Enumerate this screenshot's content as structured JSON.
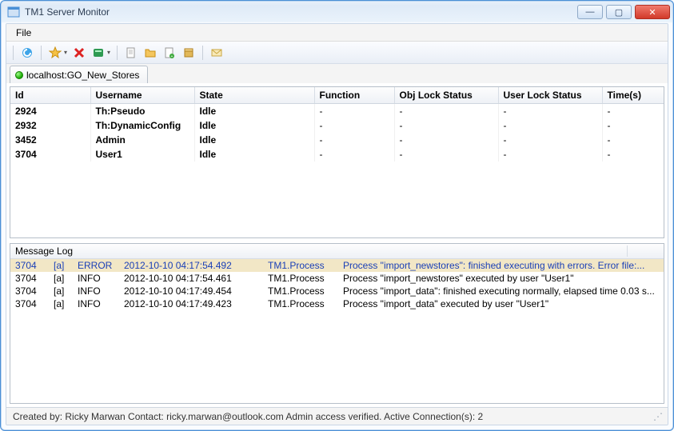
{
  "window": {
    "title": "TM1 Server Monitor"
  },
  "menubar": {
    "file": "File"
  },
  "toolbar_icons": [
    "refresh",
    "favorite",
    "delete",
    "server",
    "page",
    "folder",
    "page-add",
    "box",
    "mail"
  ],
  "tab": {
    "label": "localhost:GO_New_Stores"
  },
  "grid": {
    "headers": [
      "Id",
      "Username",
      "State",
      "Function",
      "Obj Lock Status",
      "User Lock Status",
      "Time(s)"
    ],
    "rows": [
      {
        "id": "2924",
        "user": "Th:Pseudo",
        "state": "Idle",
        "fn": "-",
        "obj": "-",
        "usr": "-",
        "time": "-"
      },
      {
        "id": "2932",
        "user": "Th:DynamicConfig",
        "state": "Idle",
        "fn": "-",
        "obj": "-",
        "usr": "-",
        "time": "-"
      },
      {
        "id": "3452",
        "user": "Admin",
        "state": "Idle",
        "fn": "-",
        "obj": "-",
        "usr": "-",
        "time": "-"
      },
      {
        "id": "3704",
        "user": "User1",
        "state": "Idle",
        "fn": "-",
        "obj": "-",
        "usr": "-",
        "time": "-"
      }
    ]
  },
  "log": {
    "title": "Message Log",
    "rows": [
      {
        "id": "3704",
        "tag": "[a]",
        "level": "ERROR",
        "ts": "2012-10-10 04:17:54.492",
        "src": "TM1.Process",
        "msg": "Process \"import_newstores\":  finished executing with errors. Error file:...",
        "sel": true
      },
      {
        "id": "3704",
        "tag": "[a]",
        "level": "INFO",
        "ts": "2012-10-10 04:17:54.461",
        "src": "TM1.Process",
        "msg": "Process \"import_newstores\" executed by user \"User1\"",
        "sel": false
      },
      {
        "id": "3704",
        "tag": "[a]",
        "level": "INFO",
        "ts": "2012-10-10 04:17:49.454",
        "src": "TM1.Process",
        "msg": "Process \"import_data\":  finished executing normally, elapsed time 0.03 s...",
        "sel": false
      },
      {
        "id": "3704",
        "tag": "[a]",
        "level": "INFO",
        "ts": "2012-10-10 04:17:49.423",
        "src": "TM1.Process",
        "msg": "Process \"import_data\" executed by user \"User1\"",
        "sel": false
      }
    ]
  },
  "statusbar": {
    "text": "Created by: Ricky Marwan Contact: ricky.marwan@outlook.com   Admin access verified. Active Connection(s): 2"
  }
}
